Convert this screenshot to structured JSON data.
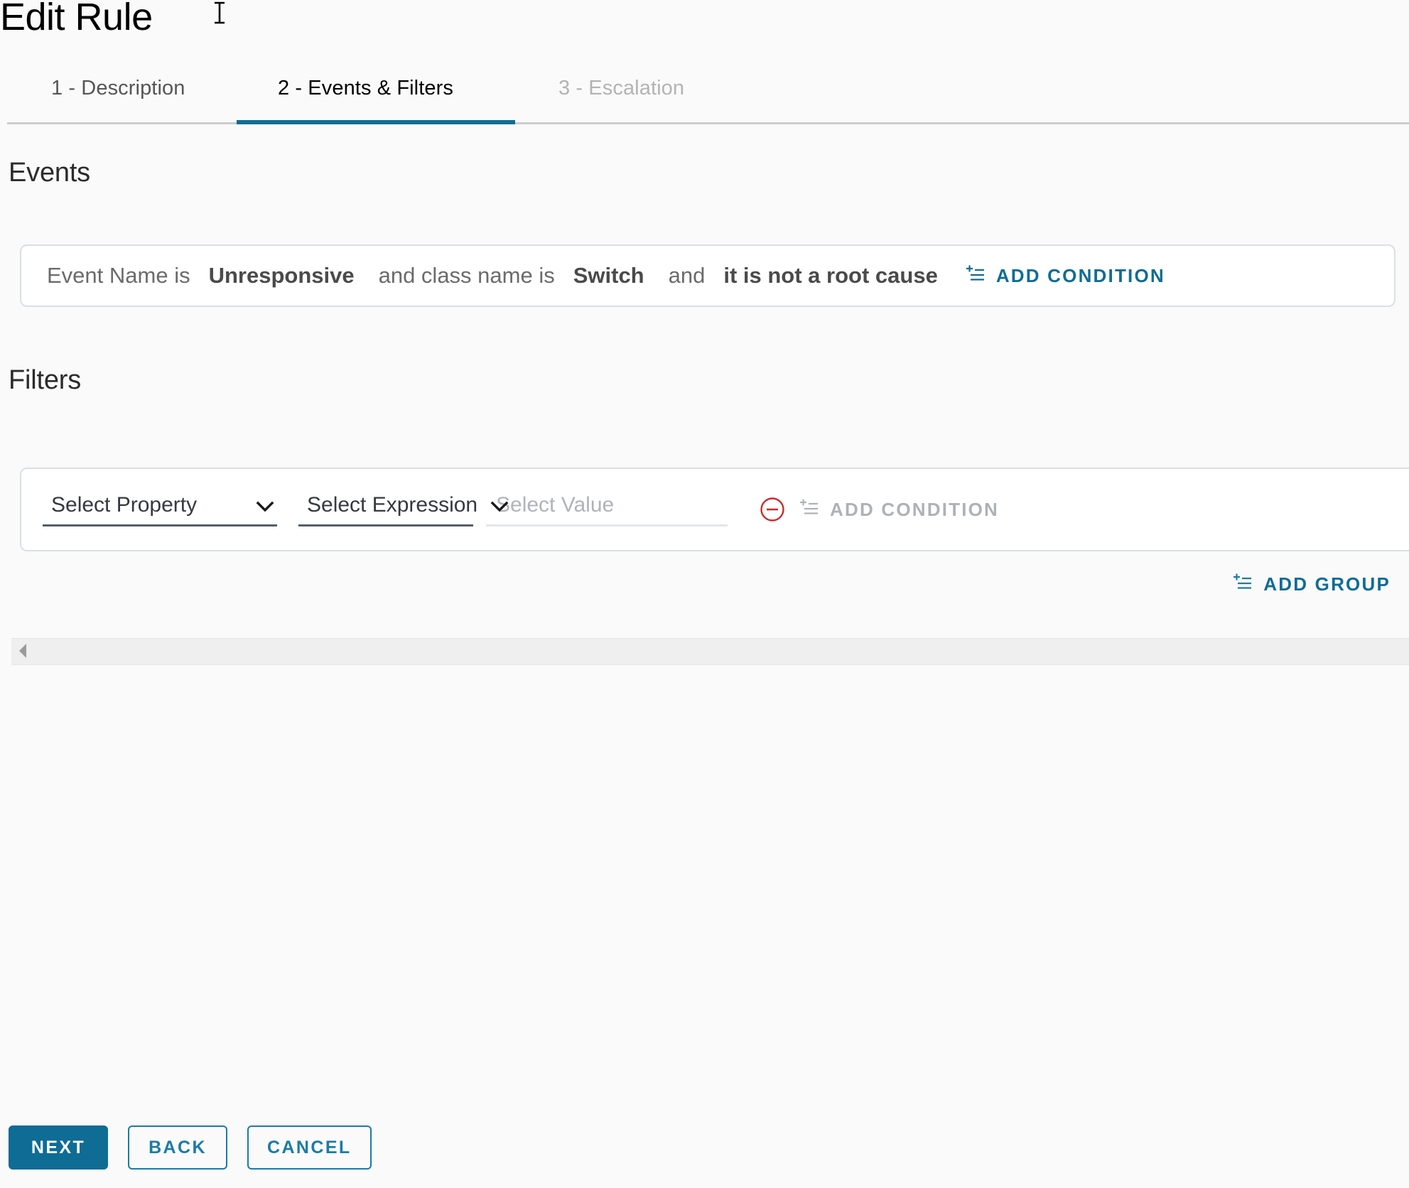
{
  "header": {
    "title": "Edit Rule",
    "cursor_icon": "text-cursor-icon"
  },
  "tabs": {
    "active_index": 1,
    "items": [
      {
        "label": "1 - Description",
        "state": "inactive"
      },
      {
        "label": "2 - Events & Filters",
        "state": "active"
      },
      {
        "label": "3 - Escalation",
        "state": "disabled"
      }
    ]
  },
  "events": {
    "heading": "Events",
    "expression": {
      "prefix_label": "Event Name is",
      "event_name_value": "Unresponsive",
      "conjunction_1": "and class name is",
      "class_name_value": "Switch",
      "conjunction_2": "and",
      "root_cause_value": "it is not a root cause"
    },
    "add_condition_label": "ADD CONDITION",
    "add_condition_icon": "add-list-icon"
  },
  "filters": {
    "heading": "Filters",
    "row": {
      "property_select": {
        "value": "Select Property",
        "icon": "chevron-down-icon"
      },
      "expression_select": {
        "value": "Select Expression",
        "icon": "chevron-down-icon"
      },
      "value_input": {
        "value": "",
        "placeholder": "Select Value"
      },
      "remove_icon": "minus-circle-icon",
      "add_condition_label": "ADD CONDITION",
      "add_condition_icon": "add-list-icon",
      "add_condition_enabled": false
    },
    "add_group_label": "ADD GROUP",
    "add_group_icon": "add-list-icon"
  },
  "scrollbar": {
    "left_arrow_icon": "caret-left-icon"
  },
  "footer": {
    "next_label": "NEXT",
    "back_label": "BACK",
    "cancel_label": "CANCEL"
  },
  "colors": {
    "accent": "#0f6c95",
    "accent_outline": "#1b7ba6",
    "danger": "#cf2a2a",
    "disabled_text": "#aeb2b5",
    "card_border": "#d9e0e5",
    "page_background": "#fafafa"
  }
}
